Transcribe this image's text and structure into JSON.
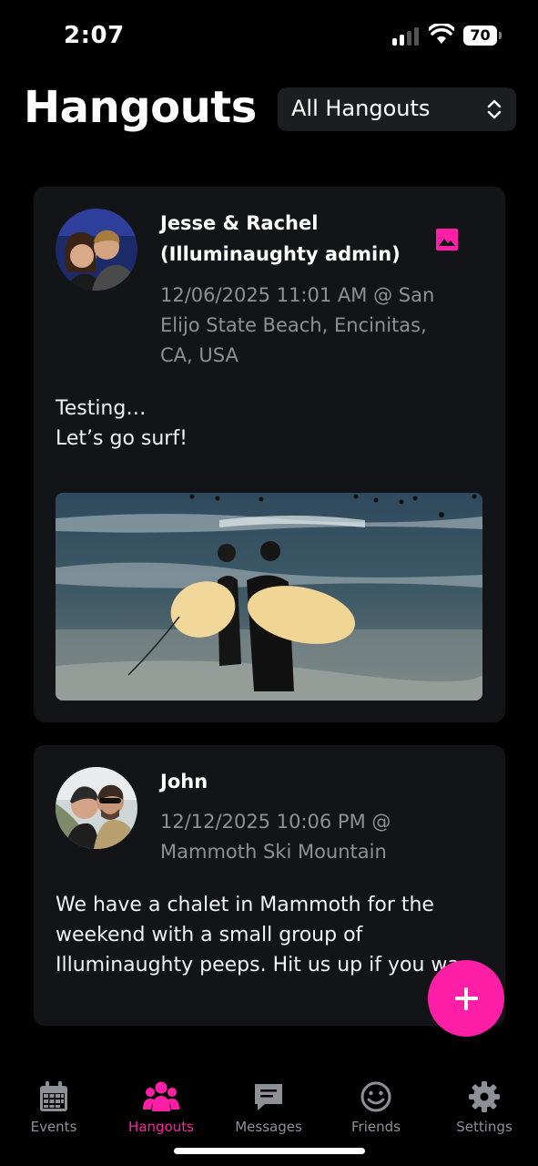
{
  "status_bar": {
    "time": "2:07",
    "battery": "70"
  },
  "header": {
    "title": "Hangouts",
    "filter": "All Hangouts"
  },
  "posts": [
    {
      "author_line1": "Jesse & Rachel",
      "author_line2": "(Illuminaughty admin)",
      "meta_line1": "12/06/2025 11:01 AM @ San",
      "meta_line2": "Elijo State Beach, Encinitas,",
      "meta_line3": "CA, USA",
      "body_line1": "Testing…",
      "body_line2": "Let’s go surf!",
      "has_photo": true
    },
    {
      "author": "John",
      "meta_line1": "12/12/2025 10:06 PM @",
      "meta_line2": "Mammoth Ski Mountain",
      "body_line1": "We have a chalet in Mammoth for the",
      "body_line2": "weekend with a small group of",
      "body_line3": "Illuminaughty peeps. Hit us up if you wa"
    }
  ],
  "fab_icon": "plus-icon",
  "tabs": [
    {
      "label": "Events",
      "icon": "calendar-icon"
    },
    {
      "label": "Hangouts",
      "icon": "people-icon",
      "active": true
    },
    {
      "label": "Messages",
      "icon": "chat-icon"
    },
    {
      "label": "Friends",
      "icon": "smiley-icon"
    },
    {
      "label": "Settings",
      "icon": "gear-icon"
    }
  ],
  "colors": {
    "accent": "#ff1fa6",
    "card": "#131417",
    "muted": "#8e9097"
  }
}
